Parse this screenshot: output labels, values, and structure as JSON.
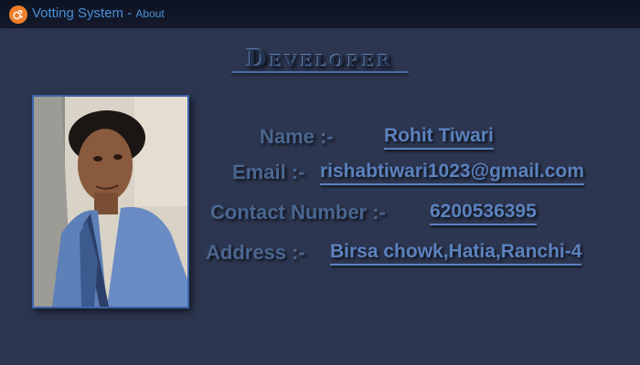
{
  "window": {
    "title": "Votting System",
    "separator": "-",
    "subtitle": "About",
    "icon": "app-logo-icon",
    "accent_color": "#f0802a"
  },
  "heading": "Developer",
  "photo": {
    "alt": "developer-photo"
  },
  "fields": {
    "name_label": "Name :-",
    "name_value": "Rohit Tiwari",
    "email_label": "Email :-",
    "email_value": "rishabtiwari1023@gmail.com",
    "contact_label": "Contact Number :-",
    "contact_value": "6200536395",
    "address_label": "Address  :-",
    "address_value": "Birsa chowk,Hatia,Ranchi-4"
  }
}
